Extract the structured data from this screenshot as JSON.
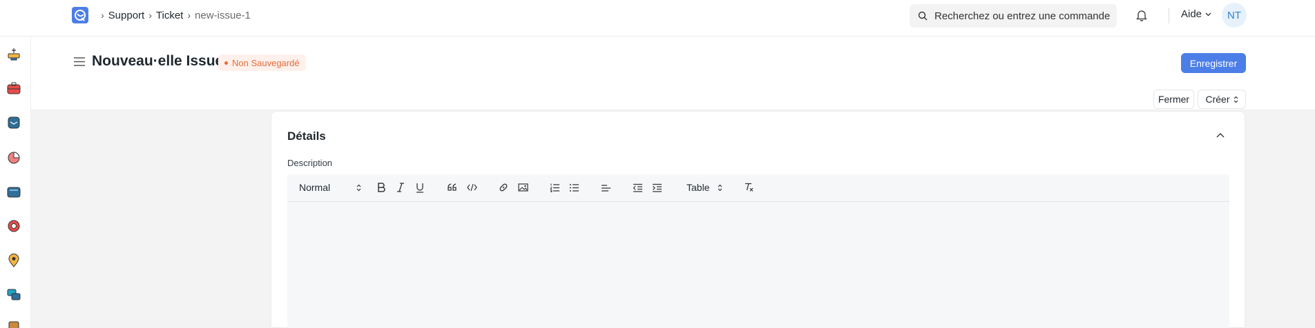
{
  "navbar": {
    "breadcrumb": [
      "Support",
      "Ticket",
      "new-issue-1"
    ],
    "search_placeholder": "Recherchez ou entrez une commande",
    "help_label": "Aide",
    "avatar_initials": "NT"
  },
  "page": {
    "title": "Nouveau·elle Issue",
    "status_badge": "Non Sauvegardé",
    "save_label": "Enregistrer",
    "close_label": "Fermer",
    "create_label": "Créer"
  },
  "form": {
    "section_title": "Détails",
    "description_label": "Description",
    "toolbar": {
      "style_select": "Normal",
      "table_select": "Table"
    }
  },
  "sidebar": {
    "icons": [
      "shop-icon",
      "toolbox-icon",
      "inbox-icon",
      "pie-chart-icon",
      "folder-icon",
      "life-ring-icon",
      "location-pin-icon",
      "chat-icon",
      "book-icon"
    ]
  },
  "colors": {
    "primary": "#4c7ee8",
    "unsaved_badge": "#e86c3a",
    "unsaved_badge_bg": "#fff0eb",
    "avatar_text": "#2f80d1",
    "avatar_bg": "#e6f1fb"
  }
}
